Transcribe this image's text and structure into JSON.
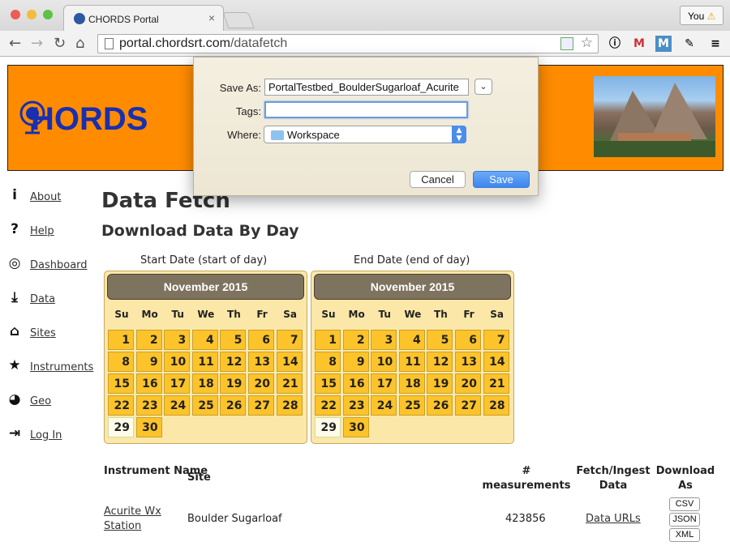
{
  "browser": {
    "tab_title": "CHORDS Portal",
    "tab_close": "×",
    "url_host": "portal.chordsrt.com",
    "url_path": "/datafetch",
    "profile_name": "You",
    "profile_warn": "⚠"
  },
  "banner": {
    "logo_text": "HORDS"
  },
  "sidebar": {
    "items": [
      {
        "label": "About",
        "icon": "info-icon",
        "glyph": "i"
      },
      {
        "label": "Help",
        "icon": "question-icon",
        "glyph": "?"
      },
      {
        "label": "Dashboard",
        "icon": "dashboard-icon",
        "glyph": "◎"
      },
      {
        "label": "Data",
        "icon": "download-icon",
        "glyph": "⤓"
      },
      {
        "label": "Sites",
        "icon": "home-icon",
        "glyph": "⌂"
      },
      {
        "label": "Instruments",
        "icon": "star-icon",
        "glyph": "★"
      },
      {
        "label": "Geo",
        "icon": "globe-icon",
        "glyph": "◕"
      },
      {
        "label": "Log In",
        "icon": "login-icon",
        "glyph": "⇥"
      }
    ]
  },
  "main": {
    "title": "Data Fetch",
    "subtitle": "Download Data By Day",
    "start_label": "Start Date (start of day)",
    "end_label": "End Date (end of day)",
    "calendar_month": "November 2015",
    "weekdays": [
      "Su",
      "Mo",
      "Tu",
      "We",
      "Th",
      "Fr",
      "Sa"
    ],
    "today": 29
  },
  "table": {
    "headers": {
      "instrument": "Instrument Name",
      "site": "Site",
      "measurements_hash": "#",
      "measurements": "measurements",
      "fetch": "Fetch/Ingest Data",
      "download": "Download As"
    },
    "row": {
      "instrument": "Acurite Wx Station",
      "site": "Boulder Sugarloaf",
      "measurements": "423856",
      "fetch": "Data URLs",
      "formats": [
        "CSV",
        "JSON",
        "XML"
      ]
    }
  },
  "dialog": {
    "save_as_label": "Save As:",
    "save_as_value": "PortalTestbed_BoulderSugarloaf_Acurite",
    "tags_label": "Tags:",
    "tags_value": "",
    "where_label": "Where:",
    "where_value": "Workspace",
    "cancel_label": "Cancel",
    "save_label": "Save"
  },
  "colors": {
    "banner": "#ff8c00",
    "logo": "#1a2fb0",
    "calendar_day": "#fcc32a",
    "calendar_bg": "#fbe7a8",
    "calendar_header": "#7e735e",
    "save_button": "#3d86ee"
  }
}
